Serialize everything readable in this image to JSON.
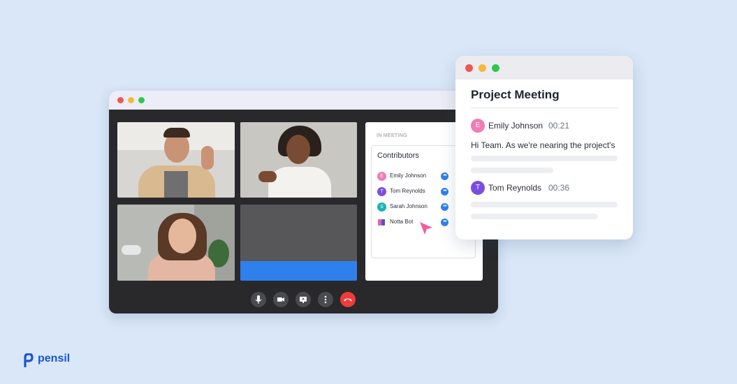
{
  "colors": {
    "background": "#d9e7f8",
    "window_dark": "#29292c",
    "accent_blue": "#2f80ed",
    "end_call_red": "#ef3b3b",
    "brand_blue": "#1a53d6"
  },
  "meeting": {
    "panel_title": "IN MEETING",
    "contributors_label": "Contributors",
    "contributors_count": "4",
    "contributors": [
      {
        "initial": "E",
        "name": "Emily Johnson",
        "color": "#f27bb3"
      },
      {
        "initial": "T",
        "name": "Tom Reynolds",
        "color": "#7a4fe0"
      },
      {
        "initial": "S",
        "name": "Sarah Johnson",
        "color": "#19b4b4"
      },
      {
        "initial": "",
        "name": "Notta Bot",
        "color": "#f05ea0"
      }
    ],
    "more_glyph": "•••",
    "controls": [
      "microphone-icon",
      "camera-icon",
      "share-screen-icon",
      "more-options-icon",
      "end-call-icon"
    ]
  },
  "chat": {
    "title": "Project Meeting",
    "messages": [
      {
        "initial": "E",
        "name": "Emily Johnson",
        "time": "00:21",
        "text": "Hi Team. As we're nearing the project's",
        "color": "#f27bb3"
      },
      {
        "initial": "T",
        "name": "Tom Reynolds",
        "time": "00:36",
        "text": "",
        "color": "#7a4fe0"
      }
    ]
  },
  "brand": {
    "name": "pensil"
  }
}
